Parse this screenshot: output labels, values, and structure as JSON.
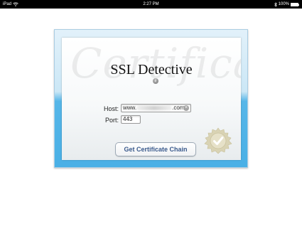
{
  "status_bar": {
    "device": "iPad",
    "time": "2:27 PM",
    "battery_percent": "100%",
    "battery_level": 1.0,
    "icons": [
      "wifi-icon",
      "bluetooth-icon",
      "battery-icon"
    ]
  },
  "app": {
    "title": "SSL Detective",
    "watermark": "Certificate",
    "info_icon": "info-icon",
    "info_glyph": "i"
  },
  "form": {
    "host_label": "Host:",
    "host_value": "www.",
    "host_value_suffix": ".com",
    "host_clear_glyph": "×",
    "port_label": "Port:",
    "port_value": "443"
  },
  "actions": {
    "get_chain_label": "Get Certificate Chain"
  },
  "colors": {
    "card_top": "#e2f1fa",
    "card_bottom": "#49b0e6",
    "button_text": "#3a5a8c",
    "seal": "#d9d3b4"
  }
}
